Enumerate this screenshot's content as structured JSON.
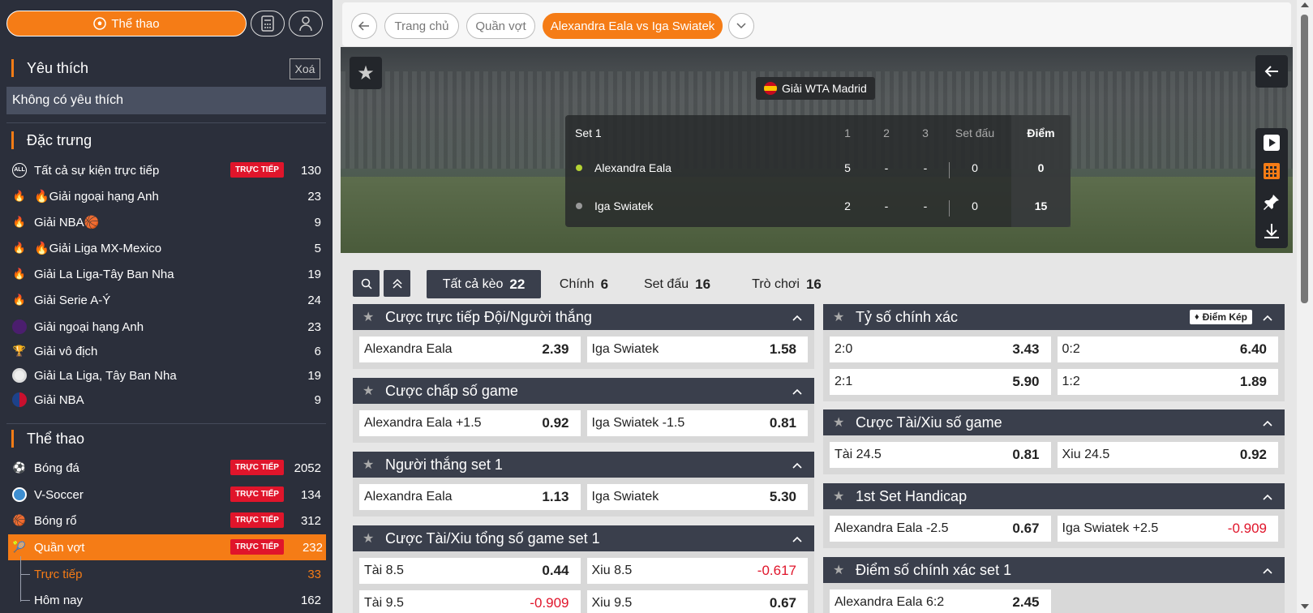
{
  "sidebar": {
    "sports_button": "Thể thao",
    "favorites": {
      "title": "Yêu thích",
      "clear": "Xoá",
      "empty": "Không có yêu thích"
    },
    "featured": {
      "title": "Đặc trưng",
      "items": [
        {
          "icon": "all-icon",
          "label": "Tất cả sự kiện trực tiếp",
          "live": "TRỰC TIẾP",
          "count": "130"
        },
        {
          "icon": "fire-icon",
          "label": "🔥Giải ngoại hạng Anh",
          "count": "23"
        },
        {
          "icon": "fire-icon",
          "label": "Giải NBA🏀",
          "count": "9"
        },
        {
          "icon": "fire-icon",
          "label": "🔥Giải Liga MX-Mexico",
          "count": "5"
        },
        {
          "icon": "fire-icon",
          "label": "Giải La Liga-Tây Ban Nha",
          "count": "19"
        },
        {
          "icon": "fire-icon",
          "label": "Giải Serie A-Ý",
          "count": "24"
        },
        {
          "icon": "premier-league-icon",
          "label": "Giải ngoại hạng Anh",
          "count": "23"
        },
        {
          "icon": "trophy-icon",
          "label": "Giải vô địch",
          "count": "6"
        },
        {
          "icon": "laliga-icon",
          "label": "Giải La Liga, Tây Ban Nha",
          "count": "19"
        },
        {
          "icon": "nba-icon",
          "label": "Giải NBA",
          "count": "9"
        }
      ]
    },
    "sports": {
      "title": "Thể thao",
      "items": [
        {
          "icon": "soccer-ball-icon",
          "label": "Bóng đá",
          "live": "TRỰC TIẾP",
          "count": "2052"
        },
        {
          "icon": "v-soccer-icon",
          "label": "V-Soccer",
          "live": "TRỰC TIẾP",
          "count": "134"
        },
        {
          "icon": "basketball-icon",
          "label": "Bóng rổ",
          "live": "TRỰC TIẾP",
          "count": "312"
        },
        {
          "icon": "tennis-ball-icon",
          "label": "Quần vợt",
          "live": "TRỰC TIẾP",
          "count": "232"
        }
      ],
      "sub": [
        {
          "label": "Trực tiếp",
          "count": "33"
        },
        {
          "label": "Hôm nay",
          "count": "162"
        }
      ]
    }
  },
  "breadcrumb": {
    "home": "Trang chủ",
    "sport": "Quần vợt",
    "match": "Alexandra Eala vs Iga Swiatek"
  },
  "match": {
    "league": "Giải WTA Madrid",
    "set_label": "Set 1",
    "headers": [
      "1",
      "2",
      "3",
      "Set đấu",
      "Điểm"
    ],
    "players": [
      {
        "name": "Alexandra Eala",
        "s1": "5",
        "s2": "-",
        "s3": "-",
        "sets": "0",
        "points": "0",
        "serving": true
      },
      {
        "name": "Iga Swiatek",
        "s1": "2",
        "s2": "-",
        "s3": "-",
        "sets": "0",
        "points": "15",
        "serving": false
      }
    ]
  },
  "tabs": [
    {
      "label": "Tất cả kèo",
      "count": "22"
    },
    {
      "label": "Chính",
      "count": "6"
    },
    {
      "label": "Set đấu",
      "count": "16"
    },
    {
      "label": "Trò chơi",
      "count": "16"
    }
  ],
  "markets_left": [
    {
      "title": "Cược trực tiếp Đội/Người thắng",
      "odds": [
        [
          "Alexandra Eala",
          "2.39"
        ],
        [
          "Iga Swiatek",
          "1.58"
        ]
      ]
    },
    {
      "title": "Cược chấp số game",
      "odds": [
        [
          "Alexandra Eala +1.5",
          "0.92"
        ],
        [
          "Iga Swiatek -1.5",
          "0.81"
        ]
      ]
    },
    {
      "title": "Người thắng set 1",
      "odds": [
        [
          "Alexandra Eala",
          "1.13"
        ],
        [
          "Iga Swiatek",
          "5.30"
        ]
      ]
    },
    {
      "title": "Cược Tài/Xiu tổng số game set 1",
      "odds": [
        [
          "Tài 8.5",
          "0.44"
        ],
        [
          "Xiu 8.5",
          "-0.617"
        ],
        [
          "Tài 9.5",
          "-0.909"
        ],
        [
          "Xiu 9.5",
          "0.67"
        ]
      ]
    }
  ],
  "markets_right": [
    {
      "title": "Tỷ số chính xác",
      "badge": "Điểm Kép",
      "odds": [
        [
          "2:0",
          "3.43"
        ],
        [
          "0:2",
          "6.40"
        ],
        [
          "2:1",
          "5.90"
        ],
        [
          "1:2",
          "1.89"
        ]
      ]
    },
    {
      "title": "Cược Tài/Xiu số game",
      "odds": [
        [
          "Tài 24.5",
          "0.81"
        ],
        [
          "Xiu 24.5",
          "0.92"
        ]
      ]
    },
    {
      "title": "1st Set Handicap",
      "odds": [
        [
          "Alexandra Eala -2.5",
          "0.67"
        ],
        [
          "Iga Swiatek +2.5",
          "-0.909"
        ]
      ]
    },
    {
      "title": "Điểm số chính xác set 1",
      "odds": [
        [
          "Alexandra Eala 6:2",
          "2.45"
        ]
      ]
    }
  ],
  "colors": {
    "accent": "#f57c16",
    "live": "#e0152b",
    "dark": "#2b2f3b",
    "header": "#3a3f4c"
  }
}
